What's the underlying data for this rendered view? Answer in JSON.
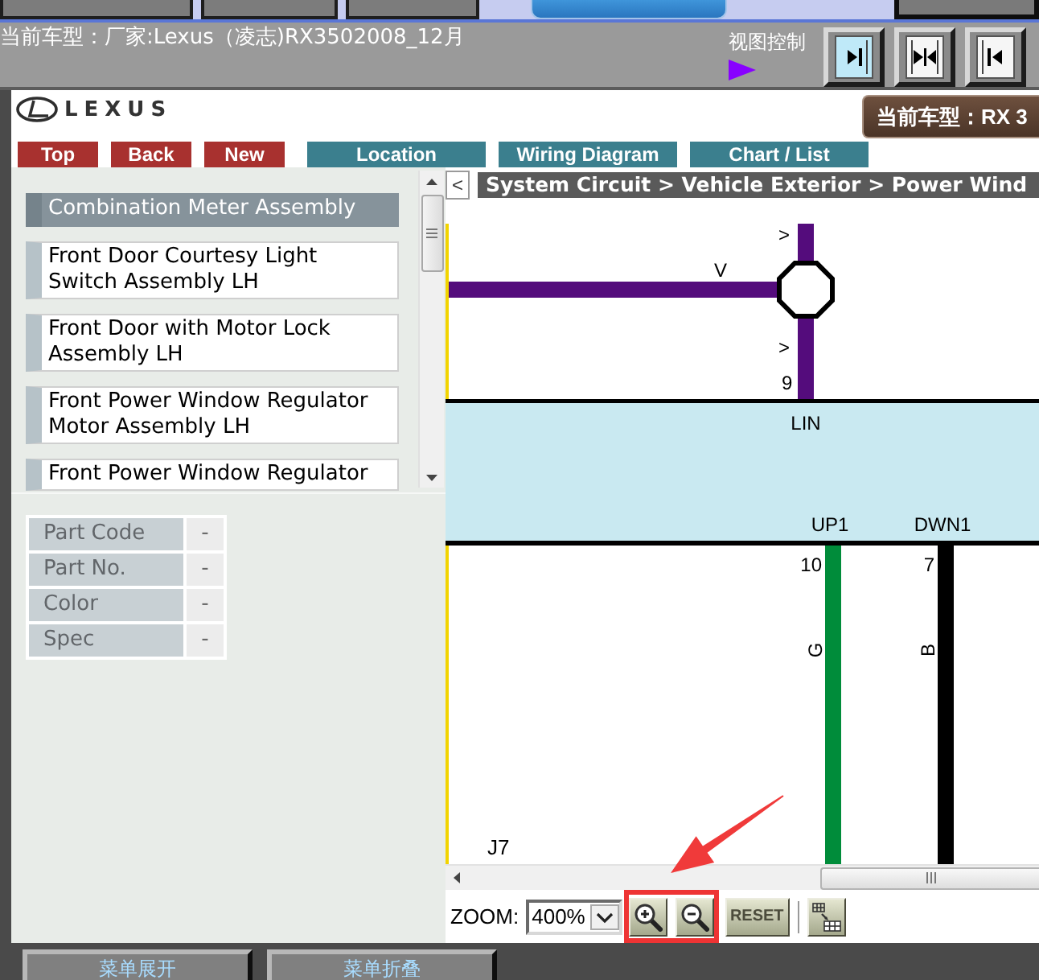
{
  "top_tabs": [
    {
      "kind": "plain"
    },
    {
      "kind": "plain"
    },
    {
      "kind": "plain"
    },
    {
      "kind": "active"
    },
    {
      "kind": "dark"
    }
  ],
  "header": {
    "title": "当前车型：厂家:Lexus（凌志)RX3502008_12月",
    "view_control_label": "视图控制",
    "view_buttons": [
      {
        "kind": "right",
        "selected": true
      },
      {
        "kind": "split",
        "selected": false
      },
      {
        "kind": "left",
        "selected": false
      }
    ]
  },
  "brand": {
    "logo": "LEXUS",
    "current_model": "当前车型：RX 3"
  },
  "nav_buttons": [
    {
      "label": "Top",
      "kind": "action"
    },
    {
      "label": "Back",
      "kind": "action"
    },
    {
      "label": "New",
      "kind": "action"
    },
    {
      "label": "Location",
      "kind": "view"
    },
    {
      "label": "Wiring Diagram",
      "kind": "view"
    },
    {
      "label": "Chart / List",
      "kind": "view"
    }
  ],
  "component_list": [
    {
      "label": "Combination Meter Assembly",
      "selected": true
    },
    {
      "label": "Front Door Courtesy Light Switch Assembly LH",
      "selected": false
    },
    {
      "label": "Front Door with Motor Lock Assembly LH",
      "selected": false
    },
    {
      "label": "Front Power Window Regulator Motor Assembly LH",
      "selected": false
    },
    {
      "label": "Front Power Window Regulator",
      "selected": false
    }
  ],
  "part_info": [
    {
      "label": "Part Code",
      "value": "-"
    },
    {
      "label": "Part No.",
      "value": "-"
    },
    {
      "label": "Color",
      "value": "-"
    },
    {
      "label": "Spec",
      "value": "-"
    }
  ],
  "diagram": {
    "collapse_label": "<",
    "breadcrumb": "System Circuit > Vehicle Exterior > Power Wind",
    "splice": {
      "color_code": "V",
      "direction_marks": [
        ">",
        ">"
      ],
      "pin": "9",
      "terminal": "LIN"
    },
    "outputs": [
      {
        "terminal": "UP1",
        "pin": "10",
        "color_code": "G",
        "color": "#008c3a"
      },
      {
        "terminal": "DWN1",
        "pin": "7",
        "color_code": "B",
        "color": "#000000"
      }
    ],
    "connector": "J7"
  },
  "zoom_bar": {
    "label": "ZOOM:",
    "value": "400%",
    "tools": [
      {
        "kind": "zoom_in"
      },
      {
        "kind": "zoom_out"
      },
      {
        "kind": "reset",
        "label": "RESET"
      },
      {
        "kind": "grid"
      }
    ]
  },
  "bottom_buttons": [
    {
      "label": "菜单展开"
    },
    {
      "label": "菜单折叠"
    }
  ]
}
